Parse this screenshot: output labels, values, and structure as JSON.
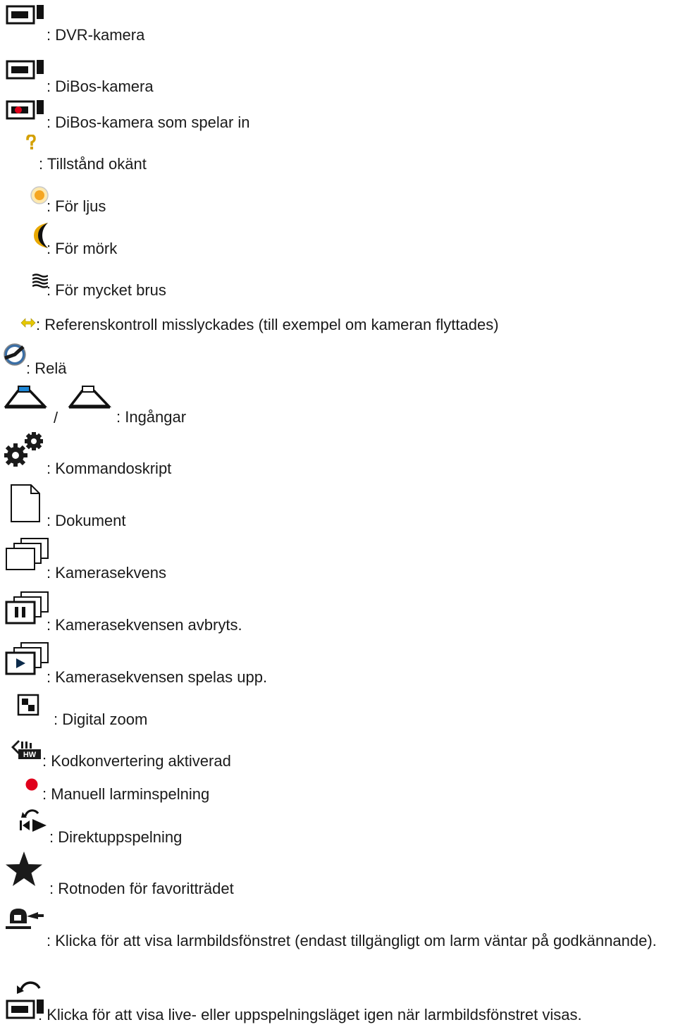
{
  "legend": {
    "items": [
      {
        "icon": "dvr-camera-icon",
        "label": ": DVR-kamera"
      },
      {
        "icon": "dibos-camera-icon",
        "label": ": DiBos-kamera"
      },
      {
        "icon": "dibos-camera-recording-icon",
        "label": ": DiBos-kamera som spelar in"
      },
      {
        "icon": "state-unknown-icon",
        "label": ": Tillstånd okänt"
      },
      {
        "icon": "too-bright-icon",
        "label": ": För ljus"
      },
      {
        "icon": "too-dark-icon",
        "label": ": För mörk"
      },
      {
        "icon": "too-noisy-icon",
        "label": ": För mycket brus"
      },
      {
        "icon": "reference-check-failed-icon",
        "label": ": Referenskontroll misslyckades (till exempel om kameran flyttades)"
      },
      {
        "icon": "relay-icon",
        "label": ": Relä"
      },
      {
        "icon": "inputs-icon",
        "separator": "/",
        "label": ": Ingångar"
      },
      {
        "icon": "command-script-icon",
        "label": ": Kommandoskript"
      },
      {
        "icon": "document-icon",
        "label": ": Dokument"
      },
      {
        "icon": "camera-sequence-icon",
        "label": ": Kamerasekvens"
      },
      {
        "icon": "camera-sequence-paused-icon",
        "label": ": Kamerasekvensen avbryts."
      },
      {
        "icon": "camera-sequence-playing-icon",
        "label": ": Kamerasekvensen spelas upp."
      },
      {
        "icon": "digital-zoom-icon",
        "label": ": Digital zoom"
      },
      {
        "icon": "transcoding-icon",
        "label": ": Kodkonvertering aktiverad"
      },
      {
        "icon": "manual-alarm-recording-icon",
        "label": ": Manuell larminspelning"
      },
      {
        "icon": "instant-playback-icon",
        "label": ": Direktuppspelning"
      },
      {
        "icon": "favorites-root-icon",
        "label": ": Rotnoden för favoritträdet"
      },
      {
        "icon": "alarm-image-window-icon",
        "label": ": Klicka för att visa larmbildsfönstret (endast tillgängligt om larm väntar på godkännande)."
      },
      {
        "icon": "back-to-live-icon",
        "label": ": Klicka för att visa live- eller uppspelningsläget igen när larmbildsfönstret visas."
      }
    ]
  },
  "colors": {
    "text": "#1a1a1a",
    "record_red": "#e0001b",
    "question_gold": "#d4a000",
    "sun_orange": "#f5a623",
    "moon_gold": "#e8a800",
    "arrow_yellow": "#e6c800",
    "input_blue": "#1e88d8",
    "relay_blue": "#3a6ea5"
  }
}
